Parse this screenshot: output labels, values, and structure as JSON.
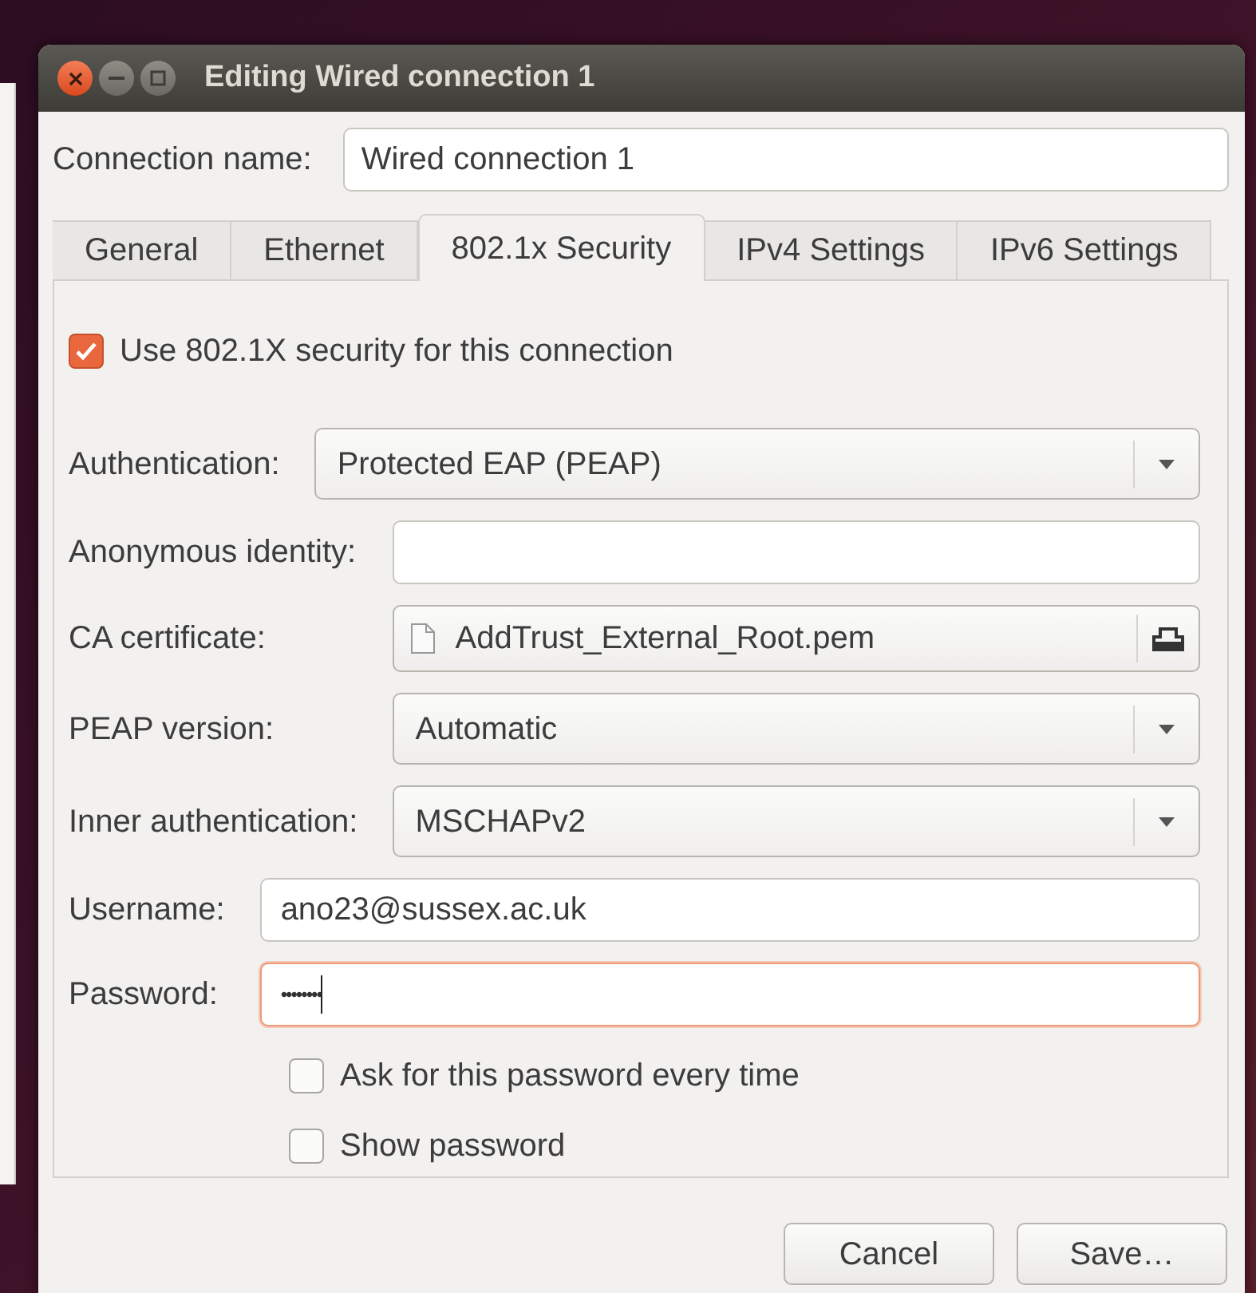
{
  "window": {
    "title": "Editing Wired connection 1"
  },
  "connection_name": {
    "label": "Connection name:",
    "value": "Wired connection 1"
  },
  "tabs": [
    {
      "label": "General",
      "selected": false
    },
    {
      "label": "Ethernet",
      "selected": false
    },
    {
      "label": "802.1x Security",
      "selected": true
    },
    {
      "label": "IPv4 Settings",
      "selected": false
    },
    {
      "label": "IPv6 Settings",
      "selected": false
    }
  ],
  "use_security": {
    "label": "Use 802.1X security for this connection",
    "checked": true
  },
  "groups": [
    {
      "fields": [
        {
          "kind": "combo",
          "label": "Authentication:",
          "value": "Protected EAP (PEAP)"
        }
      ]
    },
    {
      "fields": [
        {
          "kind": "entry",
          "label": "Anonymous identity:"
        },
        {
          "kind": "file",
          "label": "CA certificate:",
          "value": "AddTrust_External_Root.pem"
        },
        {
          "kind": "combo",
          "label": "PEAP version:",
          "value": "Automatic"
        },
        {
          "kind": "combo",
          "label": "Inner authentication:",
          "value": "MSCHAPv2"
        }
      ]
    },
    {
      "fields": [
        {
          "kind": "entry",
          "label": "Username:",
          "value": "ano23@sussex.ac.uk"
        },
        {
          "kind": "entry",
          "label": "Password:",
          "value": "••••••••",
          "focused": true
        }
      ]
    }
  ],
  "options": [
    {
      "label": "Ask for this password every time",
      "checked": false
    },
    {
      "label": "Show password",
      "checked": false
    }
  ],
  "buttons": [
    "Cancel",
    "Save…"
  ]
}
